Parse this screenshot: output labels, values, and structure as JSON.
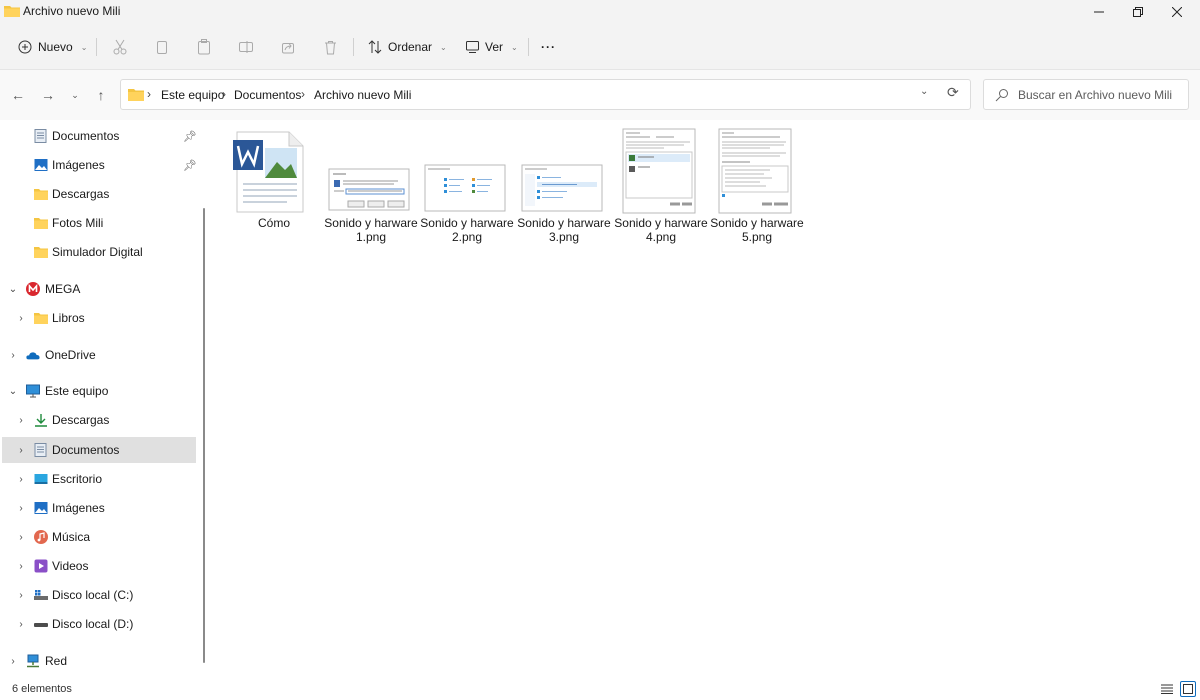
{
  "window": {
    "title": "Archivo nuevo Mili"
  },
  "toolbar": {
    "new_label": "Nuevo",
    "sort_label": "Ordenar",
    "view_label": "Ver",
    "more_label": "···"
  },
  "address": {
    "crumbs": [
      "Este equipo",
      "Documentos",
      "Archivo nuevo Mili"
    ],
    "search_placeholder": "Buscar en Archivo nuevo Mili"
  },
  "sidebar": {
    "quick_access": [
      {
        "label": "Documentos",
        "icon": "documents-icon",
        "pinned": true
      },
      {
        "label": "Imágenes",
        "icon": "pictures-icon",
        "pinned": true
      },
      {
        "label": "Descargas",
        "icon": "folder-icon",
        "pinned": false
      },
      {
        "label": "Fotos Mili",
        "icon": "folder-icon",
        "pinned": false
      },
      {
        "label": "Simulador Digital",
        "icon": "folder-icon",
        "pinned": false
      }
    ],
    "mega": {
      "label": "MEGA",
      "icon": "mega-icon"
    },
    "mega_children": [
      {
        "label": "Libros",
        "icon": "folder-icon"
      }
    ],
    "onedrive": {
      "label": "OneDrive",
      "icon": "onedrive-icon"
    },
    "this_pc": {
      "label": "Este equipo",
      "icon": "monitor-icon"
    },
    "this_pc_children": [
      {
        "label": "Descargas",
        "icon": "download-icon"
      },
      {
        "label": "Documentos",
        "icon": "documents-icon",
        "selected": true
      },
      {
        "label": "Escritorio",
        "icon": "desktop-icon"
      },
      {
        "label": "Imágenes",
        "icon": "pictures-icon"
      },
      {
        "label": "Música",
        "icon": "music-icon"
      },
      {
        "label": "Videos",
        "icon": "videos-icon"
      },
      {
        "label": "Disco local (C:)",
        "icon": "drive-c-icon"
      },
      {
        "label": "Disco local (D:)",
        "icon": "drive-icon"
      }
    ],
    "network": {
      "label": "Red",
      "icon": "network-icon"
    }
  },
  "files": [
    {
      "name": "Cómo",
      "type": "word-document"
    },
    {
      "name": "Sonido y harware 1.png",
      "type": "screenshot"
    },
    {
      "name": "Sonido y harware 2.png",
      "type": "screenshot"
    },
    {
      "name": "Sonido y harware 3.png",
      "type": "screenshot"
    },
    {
      "name": "Sonido y harware 4.png",
      "type": "screenshot"
    },
    {
      "name": "Sonido y harware 5.png",
      "type": "screenshot"
    }
  ],
  "status": {
    "count_text": "6 elementos"
  },
  "colors": {
    "folder": "#f4c542",
    "mega": "#d9272e",
    "onedrive": "#0f6cbd",
    "word": "#2b5797",
    "selected": "#e0e0e0"
  }
}
